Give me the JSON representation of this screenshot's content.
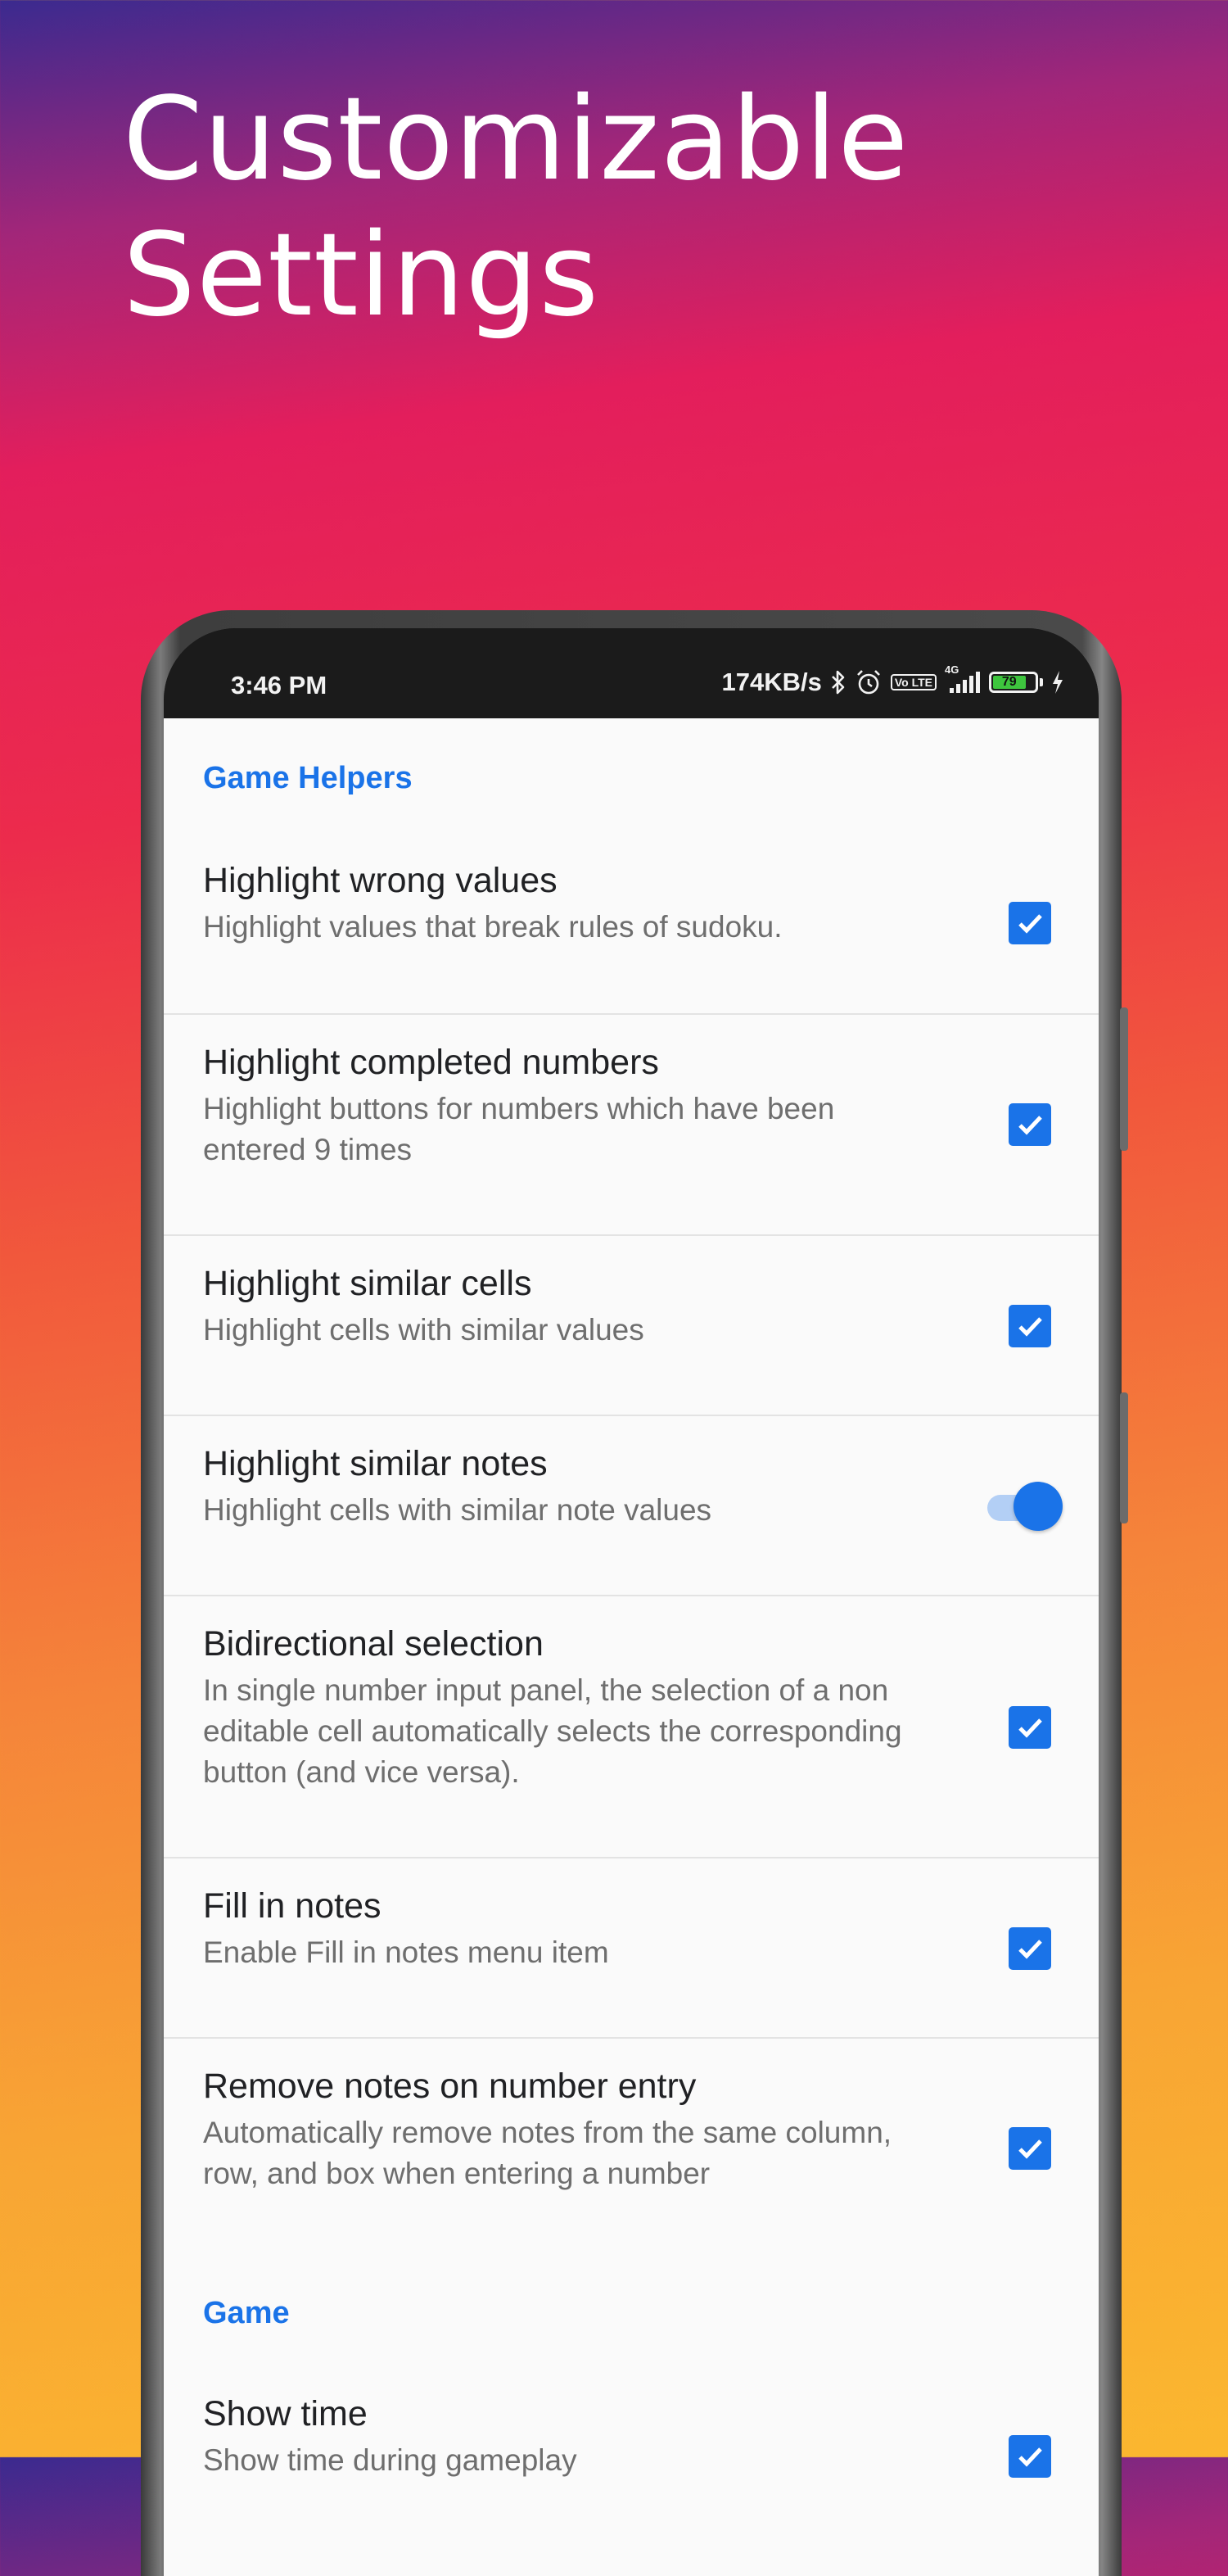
{
  "headline": {
    "line1": "Customizable",
    "line2": "Settings"
  },
  "status_bar": {
    "time": "3:46 PM",
    "net_speed": "174KB/s",
    "network_label": "4G",
    "volte_label": "Vo LTE",
    "battery_level": "79",
    "icons": [
      "bluetooth-icon",
      "alarm-icon",
      "volte-icon",
      "signal-icon",
      "battery-icon",
      "charging-icon"
    ]
  },
  "accent_color": "#1a73e8",
  "sections": [
    {
      "header": "Game Helpers",
      "items": [
        {
          "title": "Highlight wrong values",
          "summary": "Highlight values that break rules of sudoku.",
          "control": "checkbox",
          "checked": true
        },
        {
          "title": "Highlight completed numbers",
          "summary": "Highlight buttons for numbers which have been entered 9 times",
          "control": "checkbox",
          "checked": true
        },
        {
          "title": "Highlight similar cells",
          "summary": "Highlight cells with similar values",
          "control": "checkbox",
          "checked": true
        },
        {
          "title": "Highlight similar notes",
          "summary": "Highlight cells with similar note values",
          "control": "switch",
          "checked": true
        },
        {
          "title": "Bidirectional selection",
          "summary": "In single number input panel, the selection of a non editable cell automatically selects the corresponding button (and vice versa).",
          "control": "checkbox",
          "checked": true
        },
        {
          "title": "Fill in notes",
          "summary": "Enable Fill in notes menu item",
          "control": "checkbox",
          "checked": true
        },
        {
          "title": "Remove notes on number entry",
          "summary": "Automatically remove notes from the same column, row, and box when entering a number",
          "control": "checkbox",
          "checked": true
        }
      ]
    },
    {
      "header": "Game",
      "items": [
        {
          "title": "Show time",
          "summary": "Show time during gameplay",
          "control": "checkbox",
          "checked": true
        }
      ]
    }
  ]
}
